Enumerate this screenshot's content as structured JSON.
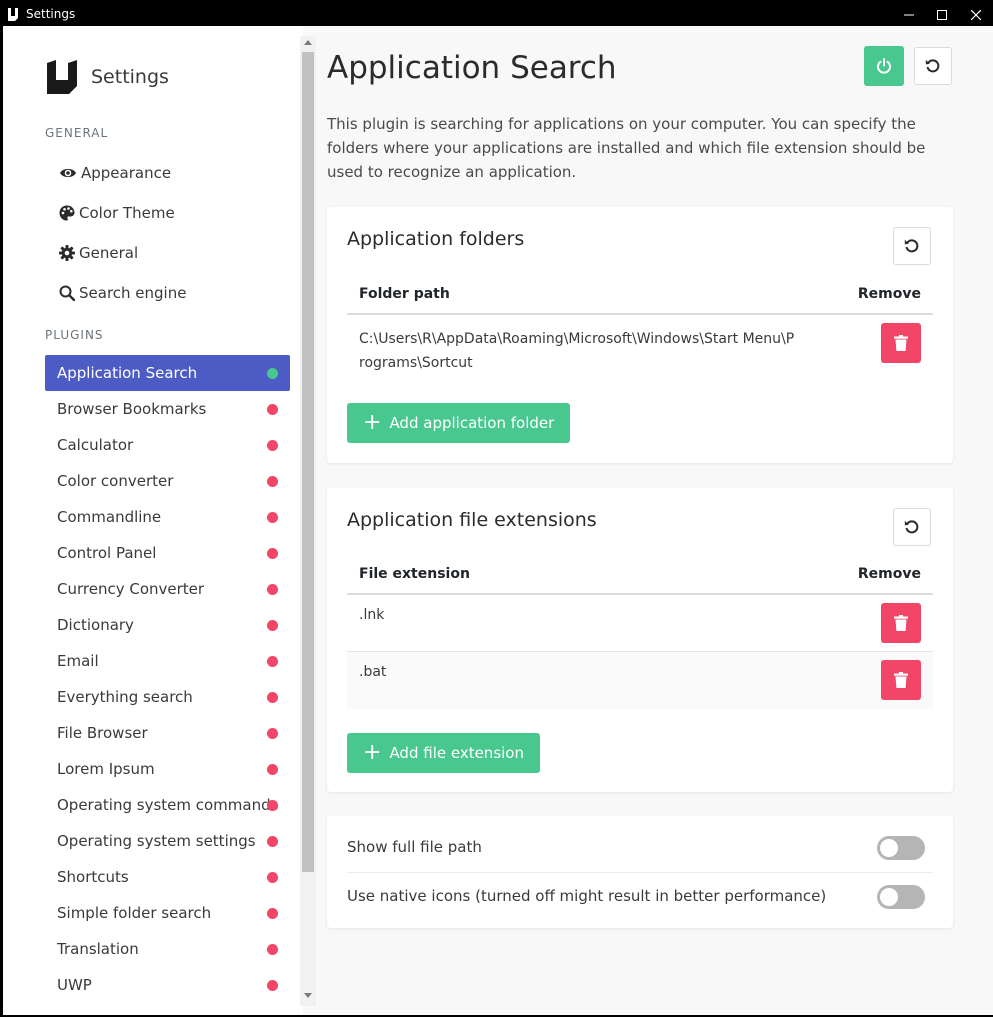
{
  "window": {
    "title": "Settings"
  },
  "sidebar": {
    "brand": "Settings",
    "general_label": "GENERAL",
    "general_items": [
      {
        "label": "Appearance",
        "icon": "eye-icon"
      },
      {
        "label": "Color Theme",
        "icon": "palette-icon"
      },
      {
        "label": "General",
        "icon": "gear-icon"
      },
      {
        "label": "Search engine",
        "icon": "search-icon"
      }
    ],
    "plugins_label": "PLUGINS",
    "plugins": [
      {
        "label": "Application Search",
        "enabled": true
      },
      {
        "label": "Browser Bookmarks",
        "enabled": false
      },
      {
        "label": "Calculator",
        "enabled": false
      },
      {
        "label": "Color converter",
        "enabled": false
      },
      {
        "label": "Commandline",
        "enabled": false
      },
      {
        "label": "Control Panel",
        "enabled": false
      },
      {
        "label": "Currency Converter",
        "enabled": false
      },
      {
        "label": "Dictionary",
        "enabled": false
      },
      {
        "label": "Email",
        "enabled": false
      },
      {
        "label": "Everything search",
        "enabled": false
      },
      {
        "label": "File Browser",
        "enabled": false
      },
      {
        "label": "Lorem Ipsum",
        "enabled": false
      },
      {
        "label": "Operating system commands",
        "enabled": false
      },
      {
        "label": "Operating system settings",
        "enabled": false
      },
      {
        "label": "Shortcuts",
        "enabled": false
      },
      {
        "label": "Simple folder search",
        "enabled": false
      },
      {
        "label": "Translation",
        "enabled": false
      },
      {
        "label": "UWP",
        "enabled": false
      }
    ],
    "colors": {
      "active_bg": "#4d5bc4",
      "enabled_dot": "#48c78e",
      "disabled_dot": "#f14668"
    }
  },
  "main": {
    "title": "Application Search",
    "description": "This plugin is searching for applications on your computer. You can specify the folders where your applications are installed and which file extension should be used to recognize an application.",
    "folders": {
      "title": "Application folders",
      "col_path": "Folder path",
      "col_remove": "Remove",
      "rows": [
        "C:\\Users\\R\\AppData\\Roaming\\Microsoft\\Windows\\Start Menu\\Programs\\Sortcut"
      ],
      "add_label": "Add application folder"
    },
    "extensions": {
      "title": "Application file extensions",
      "col_ext": "File extension",
      "col_remove": "Remove",
      "rows": [
        ".lnk",
        ".bat"
      ],
      "add_label": "Add file extension"
    },
    "options": {
      "show_full_path": {
        "label": "Show full file path",
        "enabled": false
      },
      "native_icons": {
        "label": "Use native icons (turned off might result in better performance)",
        "enabled": false
      }
    },
    "colors": {
      "success": "#48c78e",
      "danger": "#f14668"
    }
  }
}
